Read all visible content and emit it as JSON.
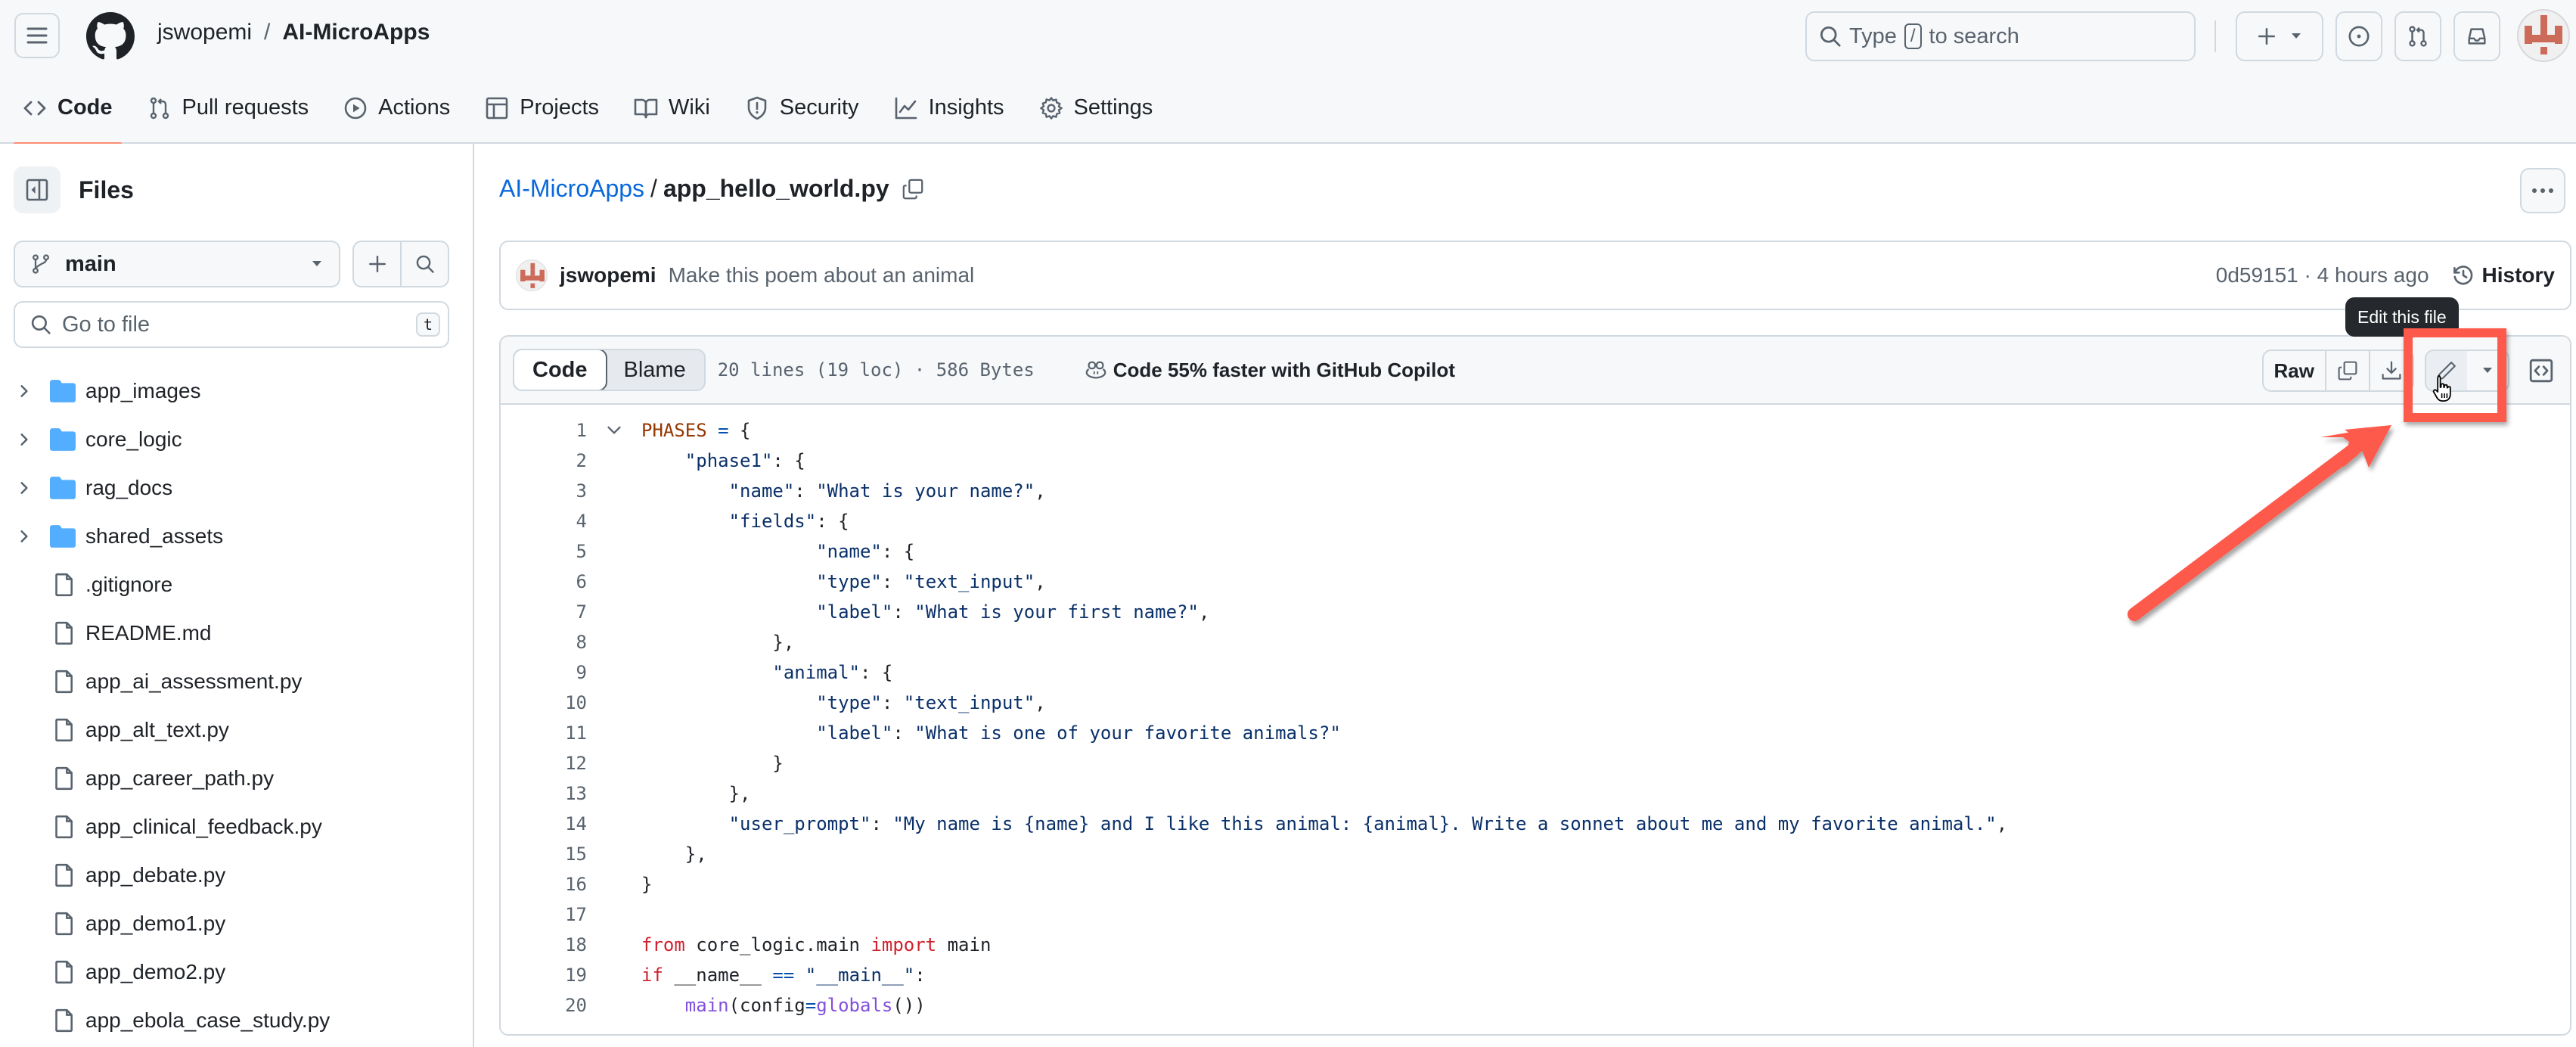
{
  "header": {
    "owner": "jswopemi",
    "separator": "/",
    "repo": "AI-MicroApps",
    "search_placeholder_pre": "Type",
    "search_key": "/",
    "search_placeholder_post": "to search"
  },
  "nav_tabs": [
    {
      "label": "Code",
      "icon": "code-icon",
      "active": true
    },
    {
      "label": "Pull requests",
      "icon": "git-pull-request-icon"
    },
    {
      "label": "Actions",
      "icon": "play-icon"
    },
    {
      "label": "Projects",
      "icon": "table-icon"
    },
    {
      "label": "Wiki",
      "icon": "book-icon"
    },
    {
      "label": "Security",
      "icon": "shield-icon"
    },
    {
      "label": "Insights",
      "icon": "graph-icon"
    },
    {
      "label": "Settings",
      "icon": "gear-icon"
    }
  ],
  "sidebar": {
    "title": "Files",
    "branch": "main",
    "goto_placeholder": "Go to file",
    "goto_shortcut": "t",
    "tree": [
      {
        "name": "app_images",
        "type": "folder"
      },
      {
        "name": "core_logic",
        "type": "folder"
      },
      {
        "name": "rag_docs",
        "type": "folder"
      },
      {
        "name": "shared_assets",
        "type": "folder"
      },
      {
        "name": ".gitignore",
        "type": "file"
      },
      {
        "name": "README.md",
        "type": "file"
      },
      {
        "name": "app_ai_assessment.py",
        "type": "file"
      },
      {
        "name": "app_alt_text.py",
        "type": "file"
      },
      {
        "name": "app_career_path.py",
        "type": "file"
      },
      {
        "name": "app_clinical_feedback.py",
        "type": "file"
      },
      {
        "name": "app_debate.py",
        "type": "file"
      },
      {
        "name": "app_demo1.py",
        "type": "file"
      },
      {
        "name": "app_demo2.py",
        "type": "file"
      },
      {
        "name": "app_ebola_case_study.py",
        "type": "file"
      }
    ]
  },
  "breadcrumb": {
    "root": "AI-MicroApps",
    "separator": "/",
    "file": "app_hello_world.py"
  },
  "commit": {
    "author": "jswopemi",
    "message": "Make this poem about an animal",
    "meta": "0d59151 · 4 hours ago",
    "history_label": "History"
  },
  "file_toolbar": {
    "code_tab": "Code",
    "blame_tab": "Blame",
    "info": "20 lines (19 loc) · 586 Bytes",
    "copilot": "Code 55% faster with GitHub Copilot",
    "raw": "Raw",
    "tooltip": "Edit this file"
  },
  "code_lines": [
    {
      "n": "1",
      "fold": true,
      "html": "<span class=\"c\">PHASES</span> <span class=\"o\">=</span> {"
    },
    {
      "n": "2",
      "html": "    <span class=\"s\">\"phase1\"</span>: {"
    },
    {
      "n": "3",
      "html": "        <span class=\"s\">\"name\"</span>: <span class=\"s\">\"What is your name?\"</span>,"
    },
    {
      "n": "4",
      "html": "        <span class=\"s\">\"fields\"</span>: {"
    },
    {
      "n": "5",
      "html": "                <span class=\"s\">\"name\"</span>: {"
    },
    {
      "n": "6",
      "html": "                <span class=\"s\">\"type\"</span>: <span class=\"s\">\"text_input\"</span>,"
    },
    {
      "n": "7",
      "html": "                <span class=\"s\">\"label\"</span>: <span class=\"s\">\"What is your first name?\"</span>,"
    },
    {
      "n": "8",
      "html": "            },"
    },
    {
      "n": "9",
      "html": "            <span class=\"s\">\"animal\"</span>: {"
    },
    {
      "n": "10",
      "html": "                <span class=\"s\">\"type\"</span>: <span class=\"s\">\"text_input\"</span>,"
    },
    {
      "n": "11",
      "html": "                <span class=\"s\">\"label\"</span>: <span class=\"s\">\"What is one of your favorite animals?\"</span>"
    },
    {
      "n": "12",
      "html": "            }"
    },
    {
      "n": "13",
      "html": "        },"
    },
    {
      "n": "14",
      "html": "        <span class=\"s\">\"user_prompt\"</span>: <span class=\"s\">\"My name is {name} and I like this animal: {animal}. Write a sonnet about me and my favorite animal.\"</span>,"
    },
    {
      "n": "15",
      "html": "    },"
    },
    {
      "n": "16",
      "html": "}"
    },
    {
      "n": "17",
      "html": ""
    },
    {
      "n": "18",
      "html": "<span class=\"k\">from</span> core_logic.main <span class=\"k\">import</span> main"
    },
    {
      "n": "19",
      "html": "<span class=\"k\">if</span> __name__ <span class=\"o\">==</span> <span class=\"s\">\"__main__\"</span>:"
    },
    {
      "n": "20",
      "html": "    <span class=\"f\">main</span>(config<span class=\"o\">=</span><span class=\"f\">globals</span>())"
    }
  ],
  "colors": {
    "accent_link": "#0969da",
    "tab_underline": "#fd8c73",
    "folder": "#54aeff",
    "annotation_red": "#fe5a4c",
    "avatar_red": "#cd6b5a"
  }
}
